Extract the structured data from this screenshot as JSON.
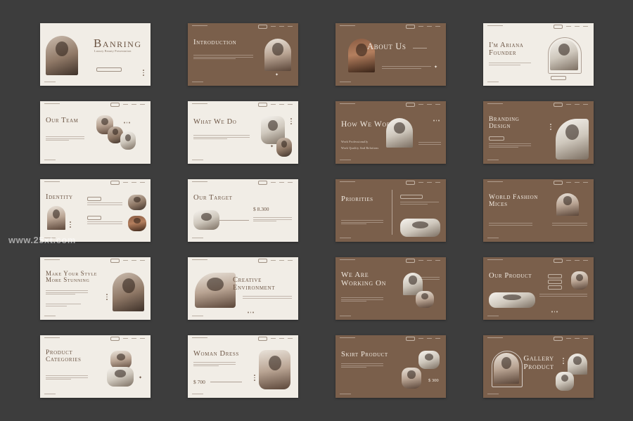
{
  "watermark": "www.25xt.com",
  "slides": {
    "s1": {
      "title": "Banring",
      "subtitle": "Luxury Beauty Presentation"
    },
    "s2": {
      "title": "Introduction"
    },
    "s3": {
      "title": "About Us"
    },
    "s4": {
      "title": "I'm Ariana Founder"
    },
    "s5": {
      "title": "Our Team"
    },
    "s6": {
      "title": "What We Do"
    },
    "s7": {
      "title": "How We Work",
      "items": [
        "Work Professionally",
        "Work Quality And Relations"
      ]
    },
    "s8": {
      "title": "Branding Design"
    },
    "s9": {
      "title": "Identity"
    },
    "s10": {
      "title": "Our Target",
      "price": "$ 8.300"
    },
    "s11": {
      "title": "Priorities"
    },
    "s12": {
      "title": "World Fashion Mices"
    },
    "s13": {
      "title": "Make Your Style More Stunning"
    },
    "s14": {
      "title": "Creative Environment"
    },
    "s15": {
      "title": "We Are Working On"
    },
    "s16": {
      "title": "Our Product"
    },
    "s17": {
      "title": "Product Categories"
    },
    "s18": {
      "title": "Woman Dress",
      "price": "$ 700"
    },
    "s19": {
      "title": "Skirt Product",
      "price": "$ 300"
    },
    "s20": {
      "title": "Gallery Product"
    }
  },
  "theme": {
    "background": "#3d3d3d",
    "light_slide": "#f1ede6",
    "dark_slide": "#7a5f4b",
    "accent_text": "#6b5443"
  }
}
